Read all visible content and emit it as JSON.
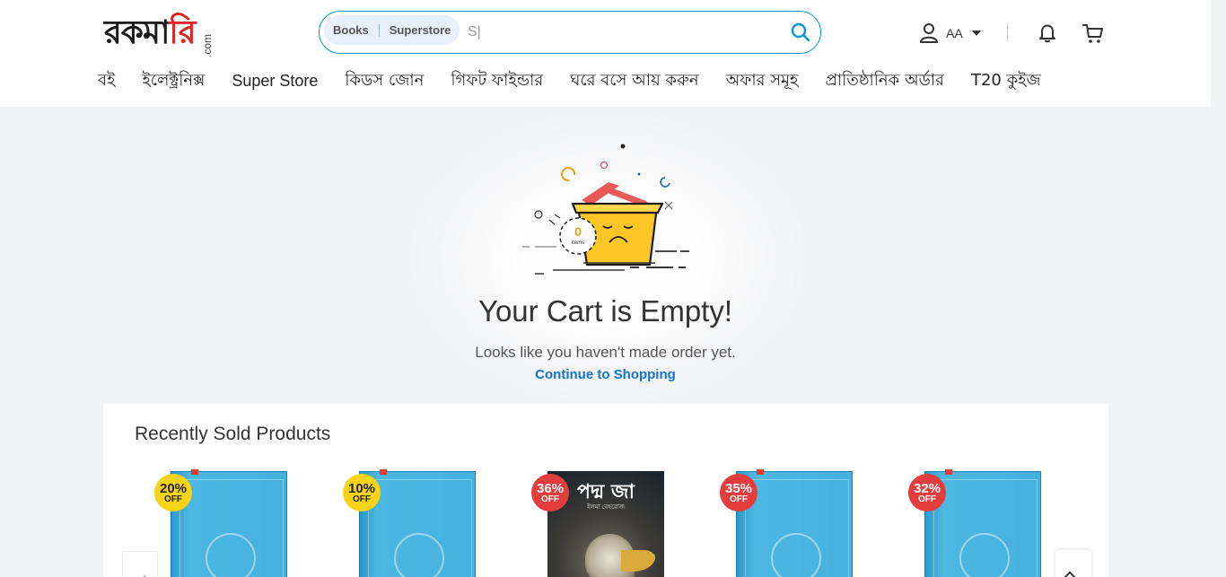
{
  "header": {
    "logo": {
      "text_part1": "রকমা",
      "text_part2": "রি",
      "suffix": ".com"
    },
    "search": {
      "scope_books": "Books",
      "scope_superstore": "Superstore",
      "placeholder": "S|"
    },
    "user": {
      "name": "AA"
    },
    "icons": {
      "user": "user-icon",
      "bell": "bell-icon",
      "cart": "cart-icon",
      "search": "search-icon"
    }
  },
  "nav": {
    "items": [
      {
        "label": "বই"
      },
      {
        "label": "ইলেক্ট্রনিক্স"
      },
      {
        "label": "Super Store"
      },
      {
        "label": "কিডস জোন"
      },
      {
        "label": "গিফট ফাইন্ডার"
      },
      {
        "label": "ঘরে বসে আয় করুন"
      },
      {
        "label": "অফার সমূহ"
      },
      {
        "label": "প্রাতিষ্ঠানিক অর্ডার"
      },
      {
        "label": "T20 কুইজ"
      }
    ]
  },
  "empty_cart": {
    "item_count": "0",
    "item_label": "items",
    "title": "Your Cart is Empty!",
    "subtitle": "Looks like you haven't made order yet.",
    "link": "Continue to Shopping"
  },
  "recent": {
    "title": "Recently Sold Products",
    "products": [
      {
        "discount": "20%",
        "off": "OFF",
        "badge_color": "yellow",
        "cover": "placeholder"
      },
      {
        "discount": "10%",
        "off": "OFF",
        "badge_color": "yellow",
        "cover": "placeholder"
      },
      {
        "discount": "36%",
        "off": "OFF",
        "badge_color": "red",
        "cover": "photo",
        "cover_title": "পদ্ম জা",
        "cover_author": "ইলমা বেহরোজ"
      },
      {
        "discount": "35%",
        "off": "OFF",
        "badge_color": "red",
        "cover": "placeholder"
      },
      {
        "discount": "32%",
        "off": "OFF",
        "badge_color": "red",
        "cover": "placeholder"
      }
    ]
  },
  "colors": {
    "brand_blue": "#0397d3",
    "link_blue": "#0f73d9",
    "badge_yellow": "#f7d417",
    "badge_red": "#e43d3d",
    "page_bg": "#f1f2f4"
  }
}
